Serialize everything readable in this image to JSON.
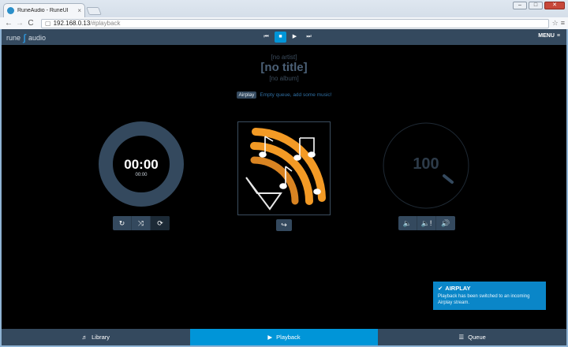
{
  "browser": {
    "tab_title": "RuneAudio - RuneUI",
    "tab_close": "×",
    "url_host": "192.168.0.13",
    "url_path": "/#playback",
    "back_icon": "←",
    "forward_icon": "→",
    "reload_icon": "C",
    "star_icon": "☆",
    "menu_icon": "≡"
  },
  "app": {
    "logo_text_left": "rune",
    "logo_text_right": "audio",
    "logo_icon": "rune-logo-icon",
    "menu_label": "MENU",
    "transport": {
      "prev": "⏮",
      "stop": "■",
      "play": "▶",
      "next": "⏭"
    },
    "now_playing": {
      "artist": "[no artist]",
      "title": "[no title]",
      "album": "[no album]",
      "source_badge": "Airplay",
      "queue_message": "Empty queue, add some music!"
    },
    "time": {
      "elapsed": "00:00",
      "total": "00:00"
    },
    "playback_controls": {
      "repeat_icon": "↻",
      "random_icon": "⤨",
      "consume_icon": "⟳"
    },
    "volume": {
      "value": "100",
      "controls": {
        "down_icon": "🔈",
        "mute_icon": "🔈!",
        "up_icon": "🔊"
      }
    },
    "share_icon": "↪",
    "notification": {
      "title": "AIRPLAY",
      "check_icon": "✔",
      "body": "Playback has been switched to an incoming Airplay stream."
    },
    "bottom_nav": [
      {
        "label": "Library",
        "icon": "♬"
      },
      {
        "label": "Playback",
        "icon": "▶"
      },
      {
        "label": "Queue",
        "icon": "☰"
      }
    ],
    "colors": {
      "accent": "#0095d8",
      "bar": "#34495e",
      "airplay_orange": "#f39a25"
    }
  }
}
